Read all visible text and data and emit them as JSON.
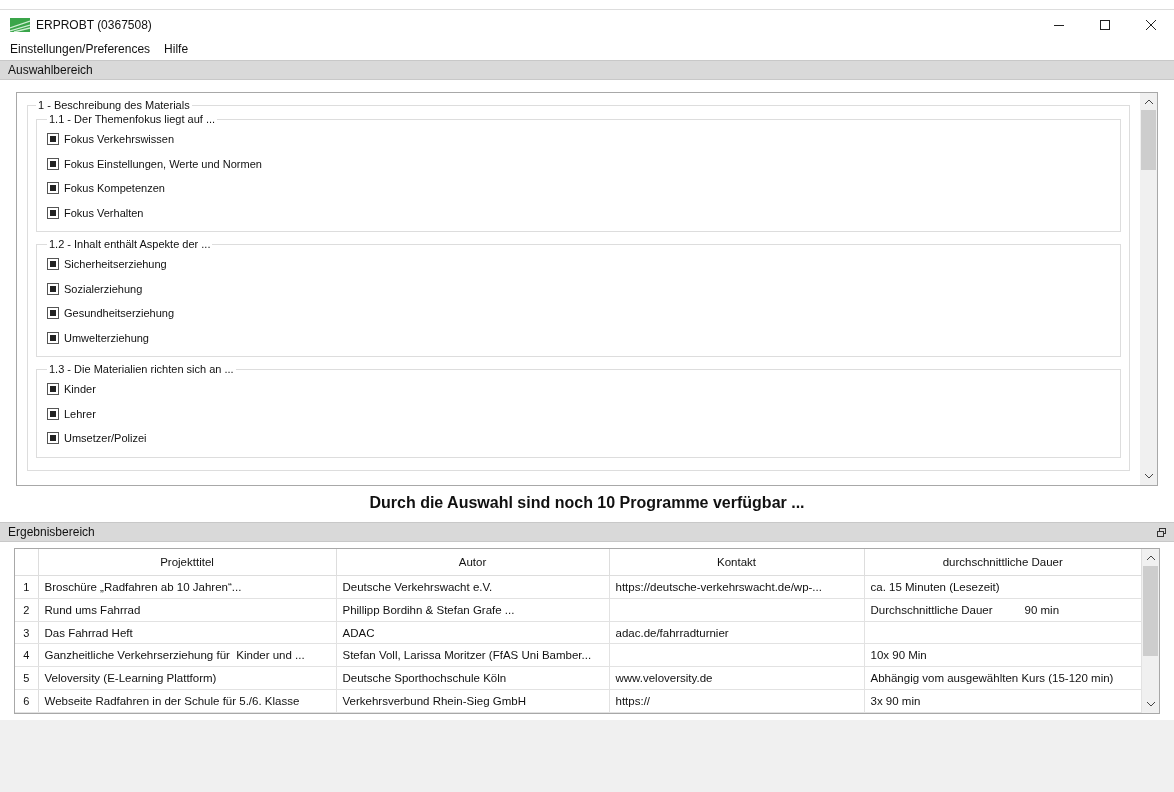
{
  "window": {
    "title": "ERPROBT (0367508)"
  },
  "menu": [
    "Einstellungen/Preferences",
    "Hilfe"
  ],
  "selection_area": {
    "title": "Auswahlbereich",
    "group": {
      "title": "1 - Beschreibung des Materials",
      "subgroups": [
        {
          "title": "1.1 - Der Themenfokus liegt auf ...",
          "items": [
            {
              "label": "Fokus Verkehrswissen",
              "checked": true
            },
            {
              "label": "Fokus Einstellungen, Werte und Normen",
              "checked": true
            },
            {
              "label": "Fokus Kompetenzen",
              "checked": true
            },
            {
              "label": "Fokus Verhalten",
              "checked": true
            }
          ]
        },
        {
          "title": "1.2 - Inhalt enthält Aspekte der ...",
          "items": [
            {
              "label": "Sicherheitserziehung",
              "checked": true
            },
            {
              "label": "Sozialerziehung",
              "checked": true
            },
            {
              "label": "Gesundheitserziehung",
              "checked": true
            },
            {
              "label": "Umwelterziehung",
              "checked": true
            }
          ]
        },
        {
          "title": "1.3 - Die Materialien richten sich an ...",
          "items": [
            {
              "label": "Kinder",
              "checked": true
            },
            {
              "label": "Lehrer",
              "checked": true
            },
            {
              "label": "Umsetzer/Polizei",
              "checked": true
            }
          ]
        }
      ]
    }
  },
  "message": "Durch die Auswahl sind noch 10 Programme verfügbar ...",
  "results_area": {
    "title": "Ergebnisbereich",
    "table": {
      "columns": [
        "Projekttitel",
        "Autor",
        "Kontakt",
        "durchschnittliche Dauer"
      ],
      "rows": [
        {
          "index": "1",
          "cells": [
            "Broschüre „Radfahren ab 10 Jahren“...",
            "Deutsche Verkehrswacht e.V.",
            "https://deutsche-verkehrswacht.de/wp-...",
            "ca. 15 Minuten (Lesezeit)"
          ]
        },
        {
          "index": "2",
          "cells": [
            "Rund ums Fahrrad",
            "Phillipp Bordihn & Stefan Grafe ...",
            "",
            "Durchschnittliche Dauer          90 min"
          ]
        },
        {
          "index": "3",
          "cells": [
            "Das Fahrrad Heft",
            "ADAC",
            "adac.de/fahrradturnier",
            ""
          ]
        },
        {
          "index": "4",
          "cells": [
            "Ganzheitliche Verkehrserziehung für  Kinder und ...",
            "Stefan Voll, Larissa Moritzer (FfAS Uni Bamber...",
            "",
            "10x 90 Min"
          ]
        },
        {
          "index": "5",
          "cells": [
            "Veloversity (E-Learning Plattform)",
            "Deutsche Sporthochschule Köln",
            "www.veloversity.de",
            "Abhängig vom ausgewählten Kurs (15-120 min)"
          ]
        },
        {
          "index": "6",
          "cells": [
            "Webseite Radfahren in der Schule für 5./6. Klasse",
            "Verkehrsverbund Rhein-Sieg GmbH",
            "https://",
            "3x 90 min"
          ]
        }
      ]
    }
  }
}
